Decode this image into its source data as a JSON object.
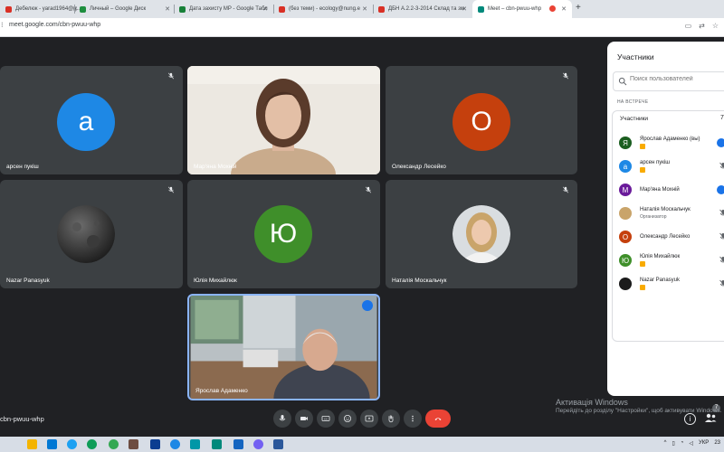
{
  "browser": {
    "tabs": [
      {
        "label": "Дебелюк - yarad1964@g...",
        "fav_color": "#d93025"
      },
      {
        "label": "Личный – Google Диск",
        "fav_color": "#1e8e3e"
      },
      {
        "label": "Дата захисту МР - Google Табл",
        "fav_color": "#188038"
      },
      {
        "label": "(без теми) - ecology@nung.e",
        "fav_color": "#d93025"
      },
      {
        "label": "ДБН А.2.2-3-2014 Склад та зм",
        "fav_color": "#d93025"
      },
      {
        "label": "Meet – cbn-pwuu-whp",
        "fav_color": "#00897b"
      }
    ],
    "new_tab": "+",
    "url": "meet.google.com/cbn-pwuu-whp"
  },
  "tiles": [
    {
      "name": "арсен пукіш",
      "letter": "а",
      "color": "#1e88e5"
    },
    {
      "name": "Мар'яна Мохній"
    },
    {
      "name": "Олександр Лесейко",
      "letter": "О",
      "color": "#c5400d"
    },
    {
      "name": "Nazar Panasyuk"
    },
    {
      "name": "Юлія Михайлюк",
      "letter": "Ю",
      "color": "#3f8f2a"
    },
    {
      "name": "Наталія Москальчук"
    },
    {
      "name": "Ярослав Адаменко"
    }
  ],
  "meeting": {
    "code": "cbn-pwuu-whp"
  },
  "panel": {
    "title": "Участники",
    "search_placeholder": "Поиск пользователей",
    "section": "НА ВСТРЕЧЕ",
    "group": "Участники",
    "group_count": "7",
    "participants": [
      {
        "name": "Ярослав Адаменко (вы)",
        "letter": "Я",
        "color": "#1b5e20",
        "badge": true
      },
      {
        "name": "арсен пукіш",
        "letter": "а",
        "color": "#1e88e5",
        "badge": true
      },
      {
        "name": "Мар'яна Мохній",
        "letter": "М",
        "color": "#6a1b9a"
      },
      {
        "name": "Наталія Москальчук",
        "sub": "Организатор"
      },
      {
        "name": "Олександр Лесейко",
        "letter": "О",
        "color": "#c5400d"
      },
      {
        "name": "Юлія Михайлюк",
        "letter": "Ю",
        "color": "#3f8f2a",
        "badge": true
      },
      {
        "name": "Nazar Panasyuk",
        "badge": true
      }
    ]
  },
  "watermark": {
    "title": "Активація Windows",
    "subtitle": "Перейдіть до розділу \"Настройки\", щоб активувати Windows."
  },
  "taskbar": {
    "language": "УКР",
    "clock": "23"
  },
  "participants_badge": "7"
}
